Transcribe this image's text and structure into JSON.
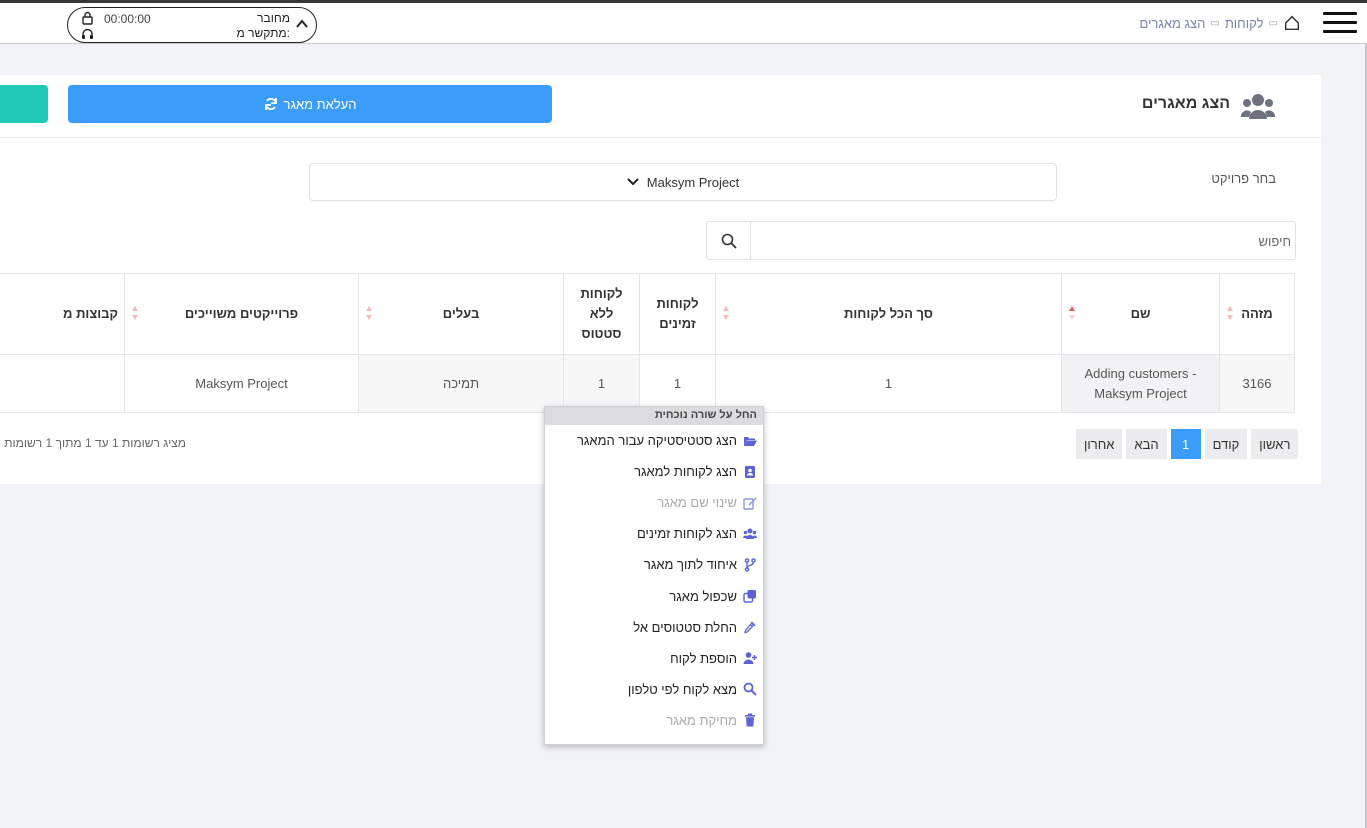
{
  "topbar": {
    "breadcrumb": [
      "לקוחות",
      "הצג מאגרים"
    ],
    "call": {
      "status": "מחובר",
      "connected_from": "מתקשר מ:",
      "timer": "00:00:00"
    }
  },
  "card": {
    "title": "הצג מאגרים",
    "upload_button": "העלאת מאגר",
    "project_label": "בחר פרויקט",
    "project_selected": "Maksym Project",
    "search_placeholder": "חיפוש"
  },
  "table": {
    "headers": [
      "מזהה",
      "שם",
      "סך הכל לקוחות",
      "לקוחות זמינים",
      "לקוחות ללא סטטוס",
      "בעלים",
      "פרוייקטים משוייכים",
      "קבוצות מ"
    ],
    "rows": [
      [
        "3166",
        "Adding customers - Maksym Project",
        "1",
        "1",
        "1",
        "תמיכה",
        "Maksym Project",
        ""
      ]
    ]
  },
  "pager": {
    "first": "ראשון",
    "prev": "קודם",
    "current": "1",
    "next": "הבא",
    "last": "אחרון"
  },
  "records_info": "מציג רשומות 1 עד 1 מתוך 1 רשומות",
  "context_menu": {
    "header": "החל על שורה נוכחית",
    "items": [
      {
        "label": "הצג סטטיסטיקה עבור המאגר",
        "icon": "folder-open-icon",
        "disabled": false
      },
      {
        "label": "הצג לקוחות למאגר",
        "icon": "address-book-icon",
        "disabled": false
      },
      {
        "label": "שינוי שם מאגר",
        "icon": "edit-icon",
        "disabled": true
      },
      {
        "label": "הצג לקוחות זמינים",
        "icon": "users-icon",
        "disabled": false
      },
      {
        "label": "איחוד לתוך מאגר",
        "icon": "merge-branch-icon",
        "disabled": false
      },
      {
        "label": "שכפול מאגר",
        "icon": "clone-icon",
        "disabled": false
      },
      {
        "label": "החלת סטטוסים אל",
        "icon": "eyedropper-icon",
        "disabled": false
      },
      {
        "label": "הוספת לקוח",
        "icon": "user-plus-icon",
        "disabled": false
      },
      {
        "label": "מצא לקוח לפי טלפון",
        "icon": "search-icon",
        "disabled": false
      },
      {
        "label": "מחיקת מאגר",
        "icon": "trash-icon",
        "disabled": true
      }
    ]
  },
  "colors": {
    "primary": "#3b9cf9",
    "teal": "#1fc7b5",
    "menu_icon": "#5a62d6",
    "sort_active": "#ef5b5b"
  }
}
